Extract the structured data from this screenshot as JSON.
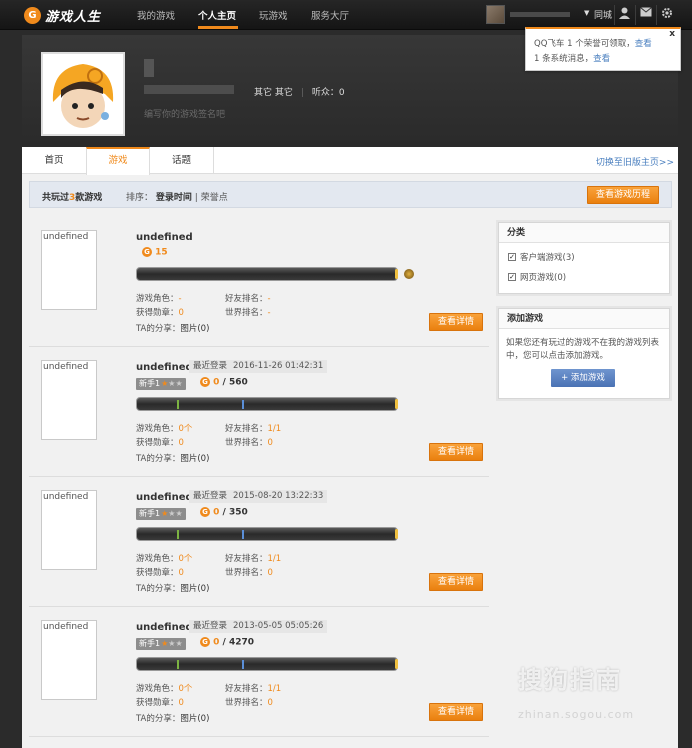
{
  "topbar": {
    "logo_char": "G",
    "logo_text": "游戏人生",
    "nav": [
      "我的游戏",
      "个人主页",
      "玩游戏",
      "服务大厅"
    ],
    "city": "同城",
    "arrow": "▼"
  },
  "profile": {
    "tags": "其它 其它",
    "fans_label": "听众：0",
    "signature": "编写你的游戏签名吧"
  },
  "tabs": [
    "首页",
    "游戏",
    "话题"
  ],
  "switch_old": "切换至旧版主页>>",
  "filter": {
    "count_prefix": "共玩过",
    "count": "3",
    "count_suffix": "款游戏",
    "sort_label": "排序：",
    "sort_active": "登录时间",
    "sort_sep": "|",
    "sort_other": "荣誉点",
    "history_button": "查看游戏历程"
  },
  "game_list": [
    {
      "image_alt": "undefined",
      "name": "undefined",
      "score": "15",
      "role_label": "游戏角色：",
      "role_value": "-",
      "friend_rank_label": "好友排名：",
      "friend_rank_value": "-",
      "medal_label": "获得勋章：",
      "medal_value": "0",
      "world_rank_label": "世界排名：",
      "world_rank_value": "-",
      "share_label": "TA的分享：",
      "share_value": "图片(0)",
      "detail_button": "查看详情"
    },
    {
      "image_alt": "undefined",
      "name": "undefined",
      "login_label": "最近登录",
      "login_time": "2016-11-26 01:42:31",
      "rank_label": "新手1",
      "score_current": "0",
      "score_sep": "/",
      "score_total": "560",
      "role_label": "游戏角色：",
      "role_value": "0个",
      "friend_rank_label": "好友排名：",
      "friend_rank_value": "1/1",
      "medal_label": "获得勋章：",
      "medal_value": "0",
      "world_rank_label": "世界排名：",
      "world_rank_value": "0",
      "share_label": "TA的分享：",
      "share_value": "图片(0)",
      "detail_button": "查看详情"
    },
    {
      "image_alt": "undefined",
      "name": "undefined",
      "login_label": "最近登录",
      "login_time": "2015-08-20 13:22:33",
      "rank_label": "新手1",
      "score_current": "0",
      "score_sep": "/",
      "score_total": "350",
      "role_label": "游戏角色：",
      "role_value": "0个",
      "friend_rank_label": "好友排名：",
      "friend_rank_value": "1/1",
      "medal_label": "获得勋章：",
      "medal_value": "0",
      "world_rank_label": "世界排名：",
      "world_rank_value": "0",
      "share_label": "TA的分享：",
      "share_value": "图片(0)",
      "detail_button": "查看详情"
    },
    {
      "image_alt": "undefined",
      "name": "undefined",
      "login_label": "最近登录",
      "login_time": "2013-05-05 05:05:26",
      "rank_label": "新手1",
      "score_current": "0",
      "score_sep": "/",
      "score_total": "4270",
      "role_label": "游戏角色：",
      "role_value": "0个",
      "friend_rank_label": "好友排名：",
      "friend_rank_value": "1/1",
      "medal_label": "获得勋章：",
      "medal_value": "0",
      "world_rank_label": "世界排名：",
      "world_rank_value": "0",
      "share_label": "TA的分享：",
      "share_value": "图片(0)",
      "detail_button": "查看详情"
    }
  ],
  "sidebar": {
    "category_title": "分类",
    "client_games": "客户端游戏(3)",
    "web_games": "网页游戏(0)",
    "add_title": "添加游戏",
    "add_text": "如果您还有玩过的游戏不在我的游戏列表中，您可以点击添加游戏。",
    "add_button": "+ 添加游戏"
  },
  "popup": {
    "close": "x",
    "line1_text": "QQ飞车 1 个荣誉可领取，",
    "line1_link": "查看",
    "line2_text": "1 条系统消息，",
    "line2_link": "查看"
  },
  "watermark": {
    "logo": "搜狗指南",
    "url": "zhinan.sogou.com"
  },
  "colors": {
    "accent": "#f08a1c",
    "link": "#4a7fbf",
    "topbar": "#1e1e1e"
  }
}
